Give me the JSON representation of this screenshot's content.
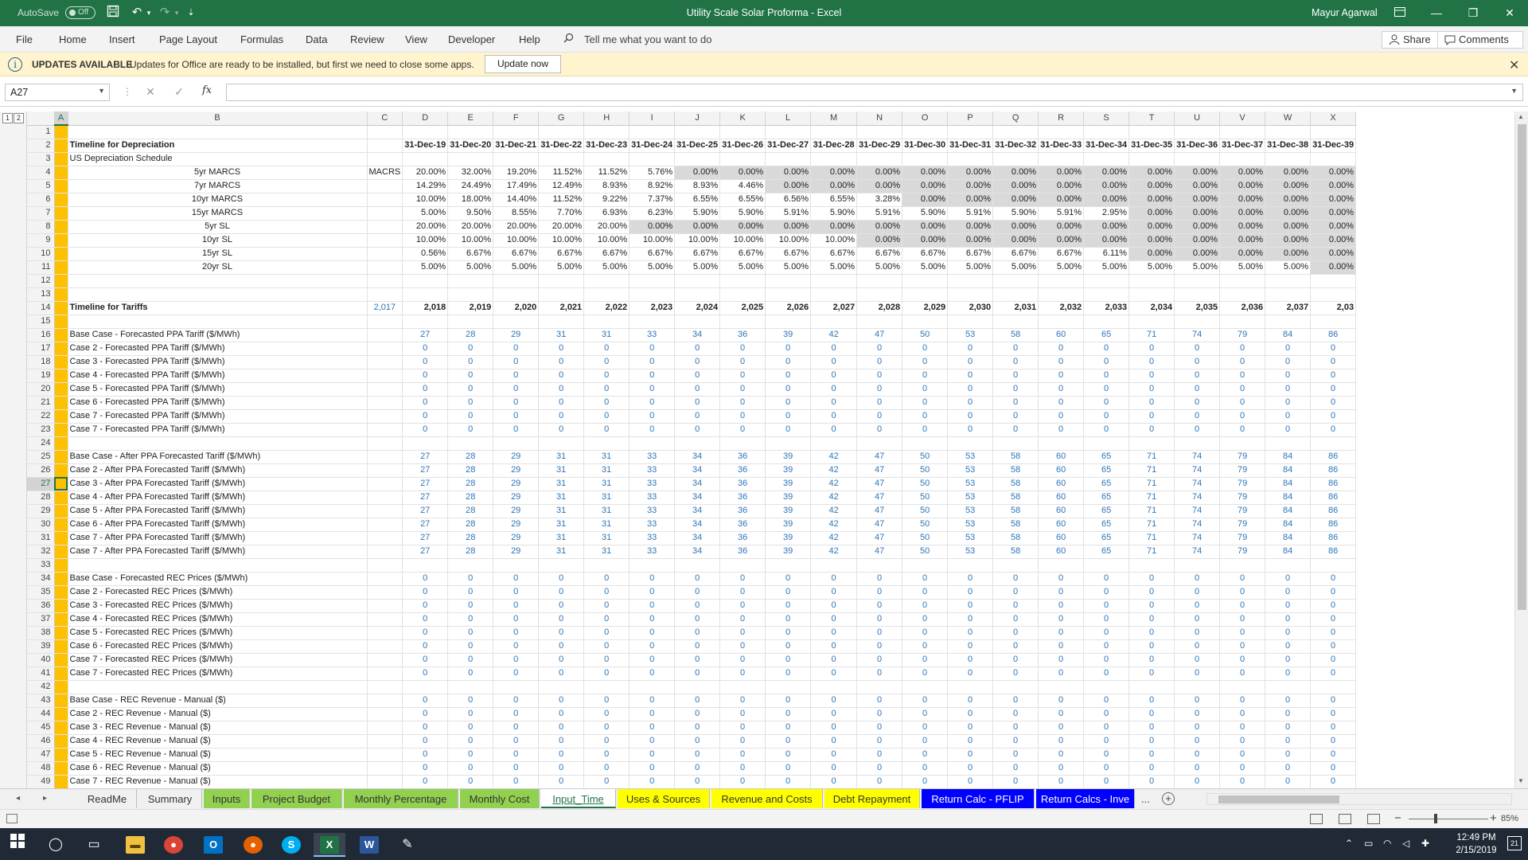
{
  "titlebar": {
    "autosave_label": "AutoSave",
    "autosave_state": "Off",
    "document_title": "Utility Scale Solar Proforma  -  Excel",
    "user_name": "Mayur Agarwal"
  },
  "menu": {
    "items": [
      "File",
      "Home",
      "Insert",
      "Page Layout",
      "Formulas",
      "Data",
      "Review",
      "View",
      "Developer",
      "Help"
    ],
    "tell_me": "Tell me what you want to do",
    "share": "Share",
    "comments": "Comments"
  },
  "message_bar": {
    "title": "UPDATES AVAILABLE",
    "text": "Updates for Office are ready to be installed, but first we need to close some apps.",
    "button": "Update now"
  },
  "formula_bar": {
    "name_box": "A27",
    "fx": "fx",
    "formula": ""
  },
  "outline_levels": [
    "1",
    "2"
  ],
  "columns": [
    "A",
    "B",
    "C",
    "D",
    "E",
    "F",
    "G",
    "H",
    "I",
    "J",
    "K",
    "L",
    "M",
    "N",
    "O",
    "P",
    "Q",
    "R",
    "S",
    "T",
    "U",
    "V",
    "W",
    "X"
  ],
  "selected_column": "A",
  "selected_row": "27",
  "depreciation": {
    "title": "Timeline for Depreciation",
    "subtitle": "US Depreciation Schedule",
    "method_label": "MACRS",
    "dates": [
      "31-Dec-19",
      "31-Dec-20",
      "31-Dec-21",
      "31-Dec-22",
      "31-Dec-23",
      "31-Dec-24",
      "31-Dec-25",
      "31-Dec-26",
      "31-Dec-27",
      "31-Dec-28",
      "31-Dec-29",
      "31-Dec-30",
      "31-Dec-31",
      "31-Dec-32",
      "31-Dec-33",
      "31-Dec-34",
      "31-Dec-35",
      "31-Dec-36",
      "31-Dec-37",
      "31-Dec-38",
      "31-Dec-39"
    ],
    "schedules": [
      {
        "label": "5yr MARCS",
        "values": [
          "20.00%",
          "32.00%",
          "19.20%",
          "11.52%",
          "11.52%",
          "5.76%",
          "0.00%",
          "0.00%",
          "0.00%",
          "0.00%",
          "0.00%",
          "0.00%",
          "0.00%",
          "0.00%",
          "0.00%",
          "0.00%",
          "0.00%",
          "0.00%",
          "0.00%",
          "0.00%",
          "0.00%"
        ],
        "gray_from": 6
      },
      {
        "label": "7yr MARCS",
        "values": [
          "14.29%",
          "24.49%",
          "17.49%",
          "12.49%",
          "8.93%",
          "8.92%",
          "8.93%",
          "4.46%",
          "0.00%",
          "0.00%",
          "0.00%",
          "0.00%",
          "0.00%",
          "0.00%",
          "0.00%",
          "0.00%",
          "0.00%",
          "0.00%",
          "0.00%",
          "0.00%",
          "0.00%"
        ],
        "gray_from": 8
      },
      {
        "label": "10yr MARCS",
        "values": [
          "10.00%",
          "18.00%",
          "14.40%",
          "11.52%",
          "9.22%",
          "7.37%",
          "6.55%",
          "6.55%",
          "6.56%",
          "6.55%",
          "3.28%",
          "0.00%",
          "0.00%",
          "0.00%",
          "0.00%",
          "0.00%",
          "0.00%",
          "0.00%",
          "0.00%",
          "0.00%",
          "0.00%"
        ],
        "gray_from": 11
      },
      {
        "label": "15yr MARCS",
        "values": [
          "5.00%",
          "9.50%",
          "8.55%",
          "7.70%",
          "6.93%",
          "6.23%",
          "5.90%",
          "5.90%",
          "5.91%",
          "5.90%",
          "5.91%",
          "5.90%",
          "5.91%",
          "5.90%",
          "5.91%",
          "2.95%",
          "0.00%",
          "0.00%",
          "0.00%",
          "0.00%",
          "0.00%"
        ],
        "gray_from": 16
      },
      {
        "label": "5yr SL",
        "values": [
          "20.00%",
          "20.00%",
          "20.00%",
          "20.00%",
          "20.00%",
          "0.00%",
          "0.00%",
          "0.00%",
          "0.00%",
          "0.00%",
          "0.00%",
          "0.00%",
          "0.00%",
          "0.00%",
          "0.00%",
          "0.00%",
          "0.00%",
          "0.00%",
          "0.00%",
          "0.00%",
          "0.00%"
        ],
        "gray_from": 5
      },
      {
        "label": "10yr SL",
        "values": [
          "10.00%",
          "10.00%",
          "10.00%",
          "10.00%",
          "10.00%",
          "10.00%",
          "10.00%",
          "10.00%",
          "10.00%",
          "10.00%",
          "0.00%",
          "0.00%",
          "0.00%",
          "0.00%",
          "0.00%",
          "0.00%",
          "0.00%",
          "0.00%",
          "0.00%",
          "0.00%",
          "0.00%"
        ],
        "gray_from": 10
      },
      {
        "label": "15yr SL",
        "values": [
          "0.56%",
          "6.67%",
          "6.67%",
          "6.67%",
          "6.67%",
          "6.67%",
          "6.67%",
          "6.67%",
          "6.67%",
          "6.67%",
          "6.67%",
          "6.67%",
          "6.67%",
          "6.67%",
          "6.67%",
          "6.11%",
          "0.00%",
          "0.00%",
          "0.00%",
          "0.00%",
          "0.00%"
        ],
        "gray_from": 16
      },
      {
        "label": "20yr SL",
        "values": [
          "5.00%",
          "5.00%",
          "5.00%",
          "5.00%",
          "5.00%",
          "5.00%",
          "5.00%",
          "5.00%",
          "5.00%",
          "5.00%",
          "5.00%",
          "5.00%",
          "5.00%",
          "5.00%",
          "5.00%",
          "5.00%",
          "5.00%",
          "5.00%",
          "5.00%",
          "5.00%",
          "0.00%"
        ],
        "gray_from": 20
      }
    ]
  },
  "tariffs": {
    "title": "Timeline for Tariffs",
    "base_year": "2,017",
    "years": [
      "2,018",
      "2,019",
      "2,020",
      "2,021",
      "2,022",
      "2,023",
      "2,024",
      "2,025",
      "2,026",
      "2,027",
      "2,028",
      "2,029",
      "2,030",
      "2,031",
      "2,032",
      "2,033",
      "2,034",
      "2,035",
      "2,036",
      "2,037",
      "2,03"
    ],
    "base_values": [
      "27",
      "28",
      "29",
      "31",
      "31",
      "33",
      "34",
      "36",
      "39",
      "42",
      "47",
      "50",
      "53",
      "58",
      "60",
      "65",
      "71",
      "74",
      "79",
      "84",
      "86"
    ],
    "forecast_ppa_labels": [
      "Base Case - Forecasted PPA Tariff ($/MWh)",
      "Case 2 - Forecasted PPA Tariff ($/MWh)",
      "Case 3 - Forecasted PPA Tariff ($/MWh)",
      "Case 4 - Forecasted PPA Tariff ($/MWh)",
      "Case 5 - Forecasted PPA Tariff ($/MWh)",
      "Case 6 - Forecasted PPA Tariff ($/MWh)",
      "Case 7 - Forecasted PPA Tariff ($/MWh)",
      "Case 7 - Forecasted PPA Tariff ($/MWh)"
    ],
    "after_ppa_labels": [
      "Base Case - After PPA Forecasted Tariff ($/MWh)",
      "Case 2 - After PPA Forecasted Tariff ($/MWh)",
      "Case 3 - After PPA Forecasted Tariff ($/MWh)",
      "Case 4 - After PPA Forecasted Tariff ($/MWh)",
      "Case 5 - After PPA Forecasted Tariff ($/MWh)",
      "Case 6 - After PPA Forecasted Tariff ($/MWh)",
      "Case 7 - After PPA Forecasted Tariff ($/MWh)",
      "Case 7 - After PPA Forecasted Tariff ($/MWh)"
    ],
    "rec_price_labels": [
      "Base Case - Forecasted REC Prices ($/MWh)",
      "Case 2 - Forecasted REC Prices ($/MWh)",
      "Case 3 - Forecasted REC Prices ($/MWh)",
      "Case 4 - Forecasted REC Prices ($/MWh)",
      "Case 5 - Forecasted REC Prices ($/MWh)",
      "Case 6 - Forecasted REC Prices ($/MWh)",
      "Case 7 - Forecasted REC Prices ($/MWh)",
      "Case 7 - Forecasted REC Prices ($/MWh)"
    ],
    "rec_revenue_labels": [
      "Base Case - REC Revenue - Manual ($)",
      "Case 2 - REC Revenue - Manual ($)",
      "Case 3 - REC Revenue - Manual ($)",
      "Case 4 - REC Revenue - Manual ($)",
      "Case 5 - REC Revenue - Manual ($)",
      "Case 6 - REC Revenue - Manual ($)",
      "Case 7 - REC Revenue - Manual ($)"
    ],
    "zero": "0"
  },
  "sheet_tabs": [
    {
      "label": "ReadMe",
      "style": "plain"
    },
    {
      "label": "Summary",
      "style": "plain"
    },
    {
      "label": "Inputs",
      "style": "green"
    },
    {
      "label": "Project Budget",
      "style": "green"
    },
    {
      "label": "Monthly Percentage",
      "style": "green"
    },
    {
      "label": "Monthly Cost",
      "style": "green"
    },
    {
      "label": "Input_Time",
      "style": "active"
    },
    {
      "label": "Uses & Sources",
      "style": "yellow"
    },
    {
      "label": "Revenue and Costs",
      "style": "yellow"
    },
    {
      "label": "Debt Repayment",
      "style": "yellow"
    },
    {
      "label": "Return Calc - PFLIP",
      "style": "blue"
    },
    {
      "label": "Return Calcs - Inve",
      "style": "blue"
    }
  ],
  "tab_overflow": "...",
  "statusbar": {
    "zoom": "85%"
  },
  "taskbar": {
    "time": "12:49 PM",
    "date": "2/15/2019",
    "notifications": "21"
  },
  "colors": {
    "excel_green": "#217346",
    "tab_green": "#92d050",
    "tab_yellow": "#ffff00",
    "tab_blue": "#0000ff",
    "orange_col": "#ffc000",
    "input_blue": "#2e75b6"
  }
}
